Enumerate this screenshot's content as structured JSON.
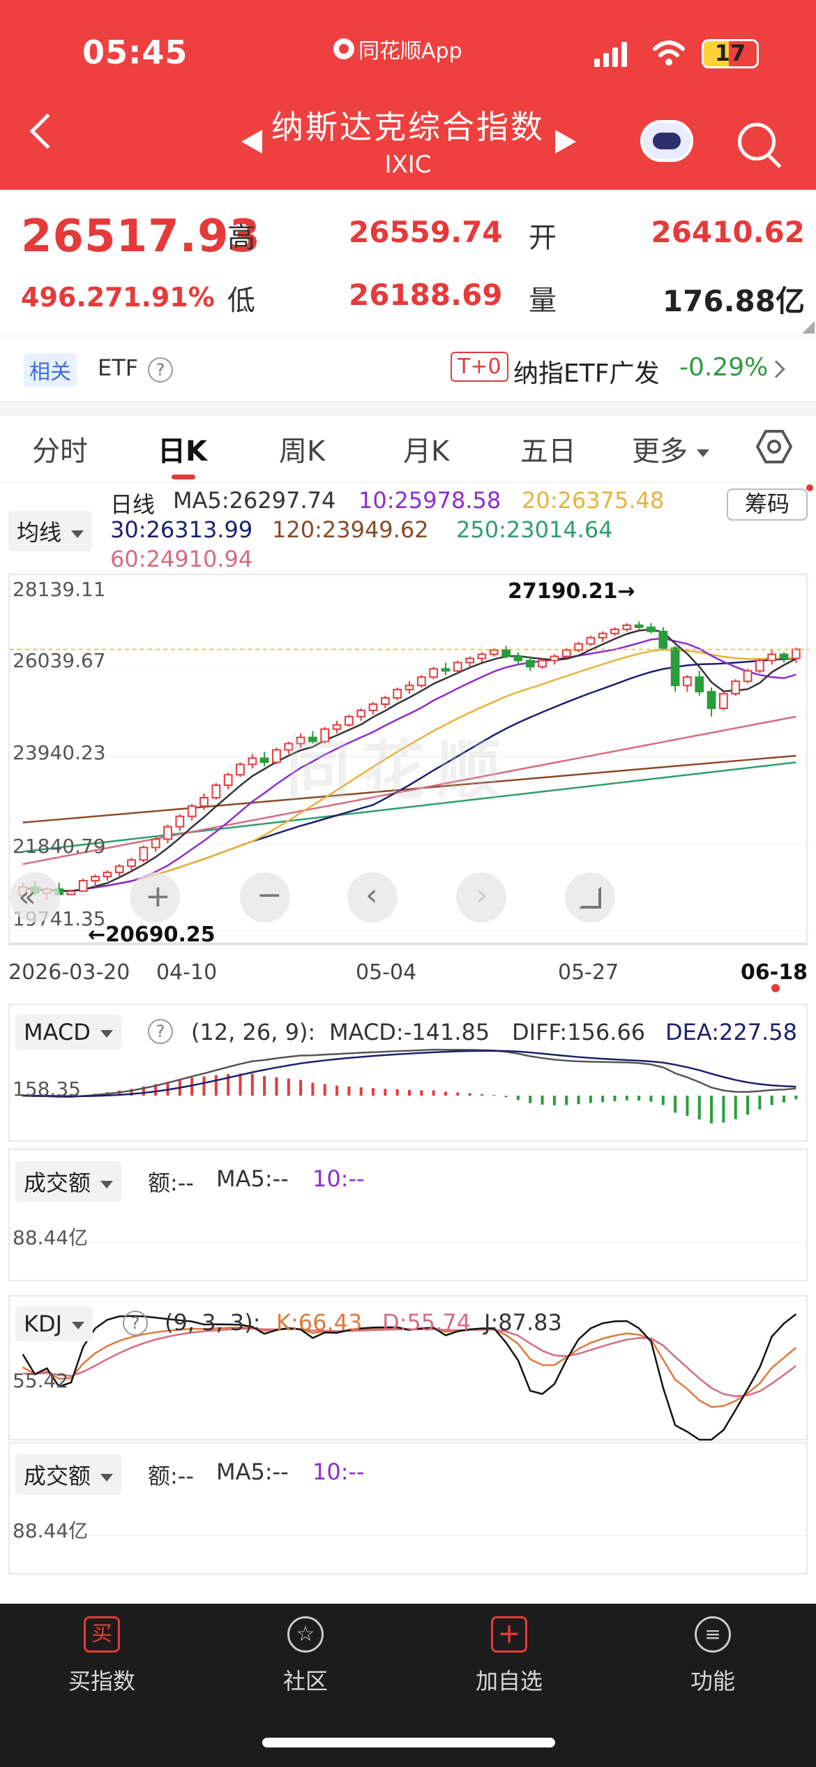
{
  "status_bar": {
    "time": "05:45",
    "app_name": "同花顺App",
    "battery": "17"
  },
  "header": {
    "title": "纳斯达克综合指数",
    "subtitle": "IXIC",
    "icons": [
      "back-icon",
      "prev-triangle-icon",
      "next-triangle-icon",
      "robot-assistant-icon",
      "search-icon"
    ]
  },
  "quote": {
    "price": "26517.93",
    "change": "496.27",
    "change_pct": "1.91%",
    "high_label": "高",
    "high": "26559.74",
    "open_label": "开",
    "open": "26410.62",
    "low_label": "低",
    "low": "26188.69",
    "volume_label": "量",
    "volume": "176.88亿"
  },
  "etf": {
    "related_tag": "相关",
    "etf_label": "ETF",
    "t0_tag": "T+0",
    "fund_name": "纳指ETF广发",
    "fund_change": "-0.29%"
  },
  "tabs": [
    {
      "label": "分时"
    },
    {
      "label": "日K"
    },
    {
      "label": "周K"
    },
    {
      "label": "月K"
    },
    {
      "label": "五日"
    },
    {
      "label": "更多"
    }
  ],
  "kline": {
    "select_label": "均线",
    "period_label": "日线",
    "chips_button": "筹码",
    "ma": {
      "ma5": "MA5:26297.74",
      "ma10": "10:25978.58",
      "ma20": "20:26375.48",
      "ma30": "30:26313.99",
      "ma120": "120:23949.62",
      "ma250": "250:23014.64",
      "ma60": "60:24910.94"
    },
    "colors": {
      "up": "#e63a3a",
      "down": "#2a9d3b",
      "ma5": "#333333",
      "ma10": "#8e2bd1",
      "ma20": "#e8b23a",
      "ma30": "#1c1f6e",
      "ma60": "#d86a82",
      "ma120": "#8a4a25",
      "ma250": "#2e9e6e"
    },
    "y_ticks": [
      "28139.11",
      "26039.67",
      "23940.23",
      "21840.79",
      "19741.35"
    ],
    "high_mark": "27190.21→",
    "low_mark": "←20690.25",
    "x_ticks": [
      "2026-03-20",
      "04-10",
      "05-04",
      "05-27",
      "06-18"
    ],
    "watermark": "同花顺"
  },
  "macd": {
    "select_label": "MACD",
    "params": "(12, 26, 9):",
    "macd": "MACD:-141.85",
    "diff": "DIFF:156.66",
    "dea": "DEA:227.58",
    "axis": "158.35"
  },
  "turnover1": {
    "select_label": "成交额",
    "amount": "额:--",
    "ma5": "MA5:--",
    "ma10": "10:--",
    "axis": "88.44亿"
  },
  "kdj": {
    "select_label": "KDJ",
    "params": "(9, 3, 3):",
    "k": "K:66.43",
    "d": "D:55.74",
    "j": "J:87.83",
    "axis": "55.42"
  },
  "turnover2": {
    "select_label": "成交额",
    "amount": "额:--",
    "ma5": "MA5:--",
    "ma10": "10:--",
    "axis": "88.44亿"
  },
  "bottom_nav": [
    {
      "label": "买指数"
    },
    {
      "label": "社区"
    },
    {
      "label": "加自选"
    },
    {
      "label": "功能"
    }
  ],
  "chart_data": {
    "type": "candlestick",
    "title": "纳斯达克综合指数 日K",
    "x_labels": [
      "2026-03-20",
      "04-10",
      "05-04",
      "05-27",
      "06-18"
    ],
    "ylim": [
      19741.35,
      28139.11
    ],
    "candles": [
      [
        20600,
        20900,
        20450,
        20800
      ],
      [
        20800,
        20950,
        20600,
        20650
      ],
      [
        20650,
        20800,
        20500,
        20750
      ],
      [
        20750,
        20900,
        20600,
        20620
      ],
      [
        20620,
        20700,
        20690,
        20700
      ],
      [
        20700,
        21000,
        20690,
        20950
      ],
      [
        20950,
        21100,
        20800,
        21050
      ],
      [
        21050,
        21200,
        20950,
        21150
      ],
      [
        21150,
        21350,
        21050,
        21300
      ],
      [
        21300,
        21500,
        21200,
        21450
      ],
      [
        21450,
        21800,
        21400,
        21750
      ],
      [
        21750,
        22000,
        21650,
        21950
      ],
      [
        21950,
        22300,
        21850,
        22250
      ],
      [
        22250,
        22550,
        22150,
        22500
      ],
      [
        22500,
        22800,
        22400,
        22750
      ],
      [
        22750,
        23050,
        22650,
        22950
      ],
      [
        22950,
        23300,
        22900,
        23250
      ],
      [
        23250,
        23550,
        23150,
        23500
      ],
      [
        23500,
        23800,
        23450,
        23750
      ],
      [
        23750,
        24000,
        23650,
        23900
      ],
      [
        23900,
        24050,
        23700,
        23800
      ],
      [
        23800,
        24150,
        23750,
        24100
      ],
      [
        24100,
        24300,
        24000,
        24250
      ],
      [
        24250,
        24500,
        24150,
        24400
      ],
      [
        24400,
        24550,
        24250,
        24300
      ],
      [
        24300,
        24650,
        24250,
        24600
      ],
      [
        24600,
        24800,
        24500,
        24700
      ],
      [
        24700,
        24950,
        24650,
        24900
      ],
      [
        24900,
        25100,
        24800,
        25050
      ],
      [
        25050,
        25250,
        24950,
        25200
      ],
      [
        25200,
        25400,
        25100,
        25350
      ],
      [
        25350,
        25600,
        25300,
        25550
      ],
      [
        25550,
        25750,
        25450,
        25650
      ],
      [
        25650,
        25900,
        25600,
        25850
      ],
      [
        25850,
        26100,
        25800,
        26050
      ],
      [
        26050,
        26200,
        25900,
        26000
      ],
      [
        26000,
        26250,
        25950,
        26200
      ],
      [
        26200,
        26350,
        26100,
        26300
      ],
      [
        26300,
        26450,
        26200,
        26400
      ],
      [
        26400,
        26550,
        26350,
        26500
      ],
      [
        26500,
        26600,
        26300,
        26350
      ],
      [
        26350,
        26450,
        26150,
        26250
      ],
      [
        26250,
        26350,
        26000,
        26100
      ],
      [
        26100,
        26300,
        26050,
        26250
      ],
      [
        26250,
        26400,
        26150,
        26350
      ],
      [
        26350,
        26550,
        26300,
        26500
      ],
      [
        26500,
        26700,
        26450,
        26650
      ],
      [
        26650,
        26850,
        26600,
        26800
      ],
      [
        26800,
        26950,
        26700,
        26900
      ],
      [
        26900,
        27050,
        26850,
        27000
      ],
      [
        27000,
        27150,
        26950,
        27100
      ],
      [
        27100,
        27190,
        27000,
        27050
      ],
      [
        27050,
        27150,
        26900,
        26950
      ],
      [
        26950,
        27050,
        26500,
        26550
      ],
      [
        26550,
        26600,
        25500,
        25650
      ],
      [
        25650,
        25900,
        25500,
        25850
      ],
      [
        25850,
        26000,
        25400,
        25500
      ],
      [
        25500,
        25600,
        24900,
        25100
      ],
      [
        25100,
        25500,
        25050,
        25450
      ],
      [
        25450,
        25800,
        25400,
        25750
      ],
      [
        25750,
        26050,
        25700,
        26000
      ],
      [
        26000,
        26300,
        25950,
        26250
      ],
      [
        26250,
        26500,
        26150,
        26400
      ],
      [
        26400,
        26450,
        26200,
        26300
      ],
      [
        26300,
        26560,
        26190,
        26518
      ]
    ]
  }
}
